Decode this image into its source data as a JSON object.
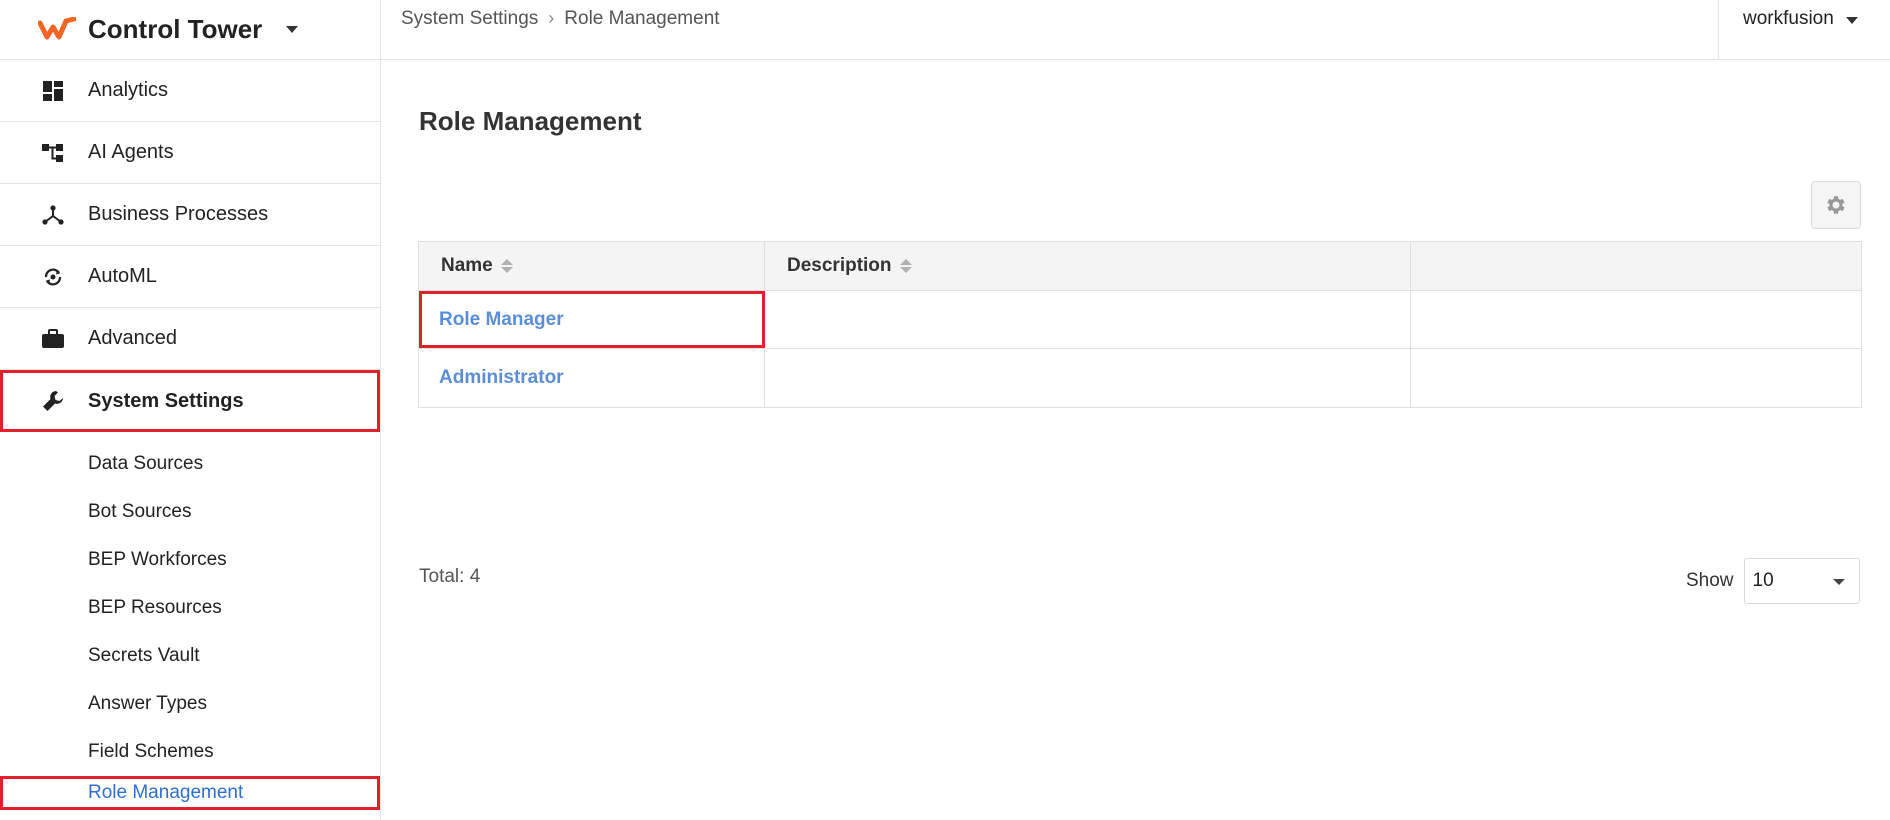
{
  "brand": {
    "title": "Control Tower",
    "logo_icon": "workfusion-logo-icon",
    "accent": "#f26522"
  },
  "sidebar": {
    "items": [
      {
        "label": "Analytics",
        "icon": "dashboard-icon"
      },
      {
        "label": "AI Agents",
        "icon": "hierarchy-icon"
      },
      {
        "label": "Business Processes",
        "icon": "process-icon"
      },
      {
        "label": "AutoML",
        "icon": "automl-icon"
      },
      {
        "label": "Advanced",
        "icon": "briefcase-icon"
      },
      {
        "label": "System Settings",
        "icon": "wrench-icon",
        "active": true
      }
    ],
    "sub_items": [
      {
        "label": "Data Sources"
      },
      {
        "label": "Bot Sources"
      },
      {
        "label": "BEP Workforces"
      },
      {
        "label": "BEP Resources"
      },
      {
        "label": "Secrets Vault"
      },
      {
        "label": "Answer Types"
      },
      {
        "label": "Field Schemes"
      },
      {
        "label": "Role Management",
        "current": true
      }
    ]
  },
  "breadcrumb": {
    "parent": "System Settings",
    "current": "Role Management"
  },
  "user": {
    "name": "workfusion"
  },
  "page": {
    "title": "Role Management",
    "table": {
      "columns": [
        "Name",
        "Description",
        ""
      ],
      "rows": [
        {
          "name": "Role Manager",
          "description": ""
        },
        {
          "name": "Administrator",
          "description": ""
        }
      ]
    },
    "total": "Total: 4",
    "show_label": "Show",
    "page_size": "10"
  },
  "colors": {
    "highlight": "#e0202a",
    "link": "#5b8ed8",
    "current_link": "#2f6fd1"
  }
}
